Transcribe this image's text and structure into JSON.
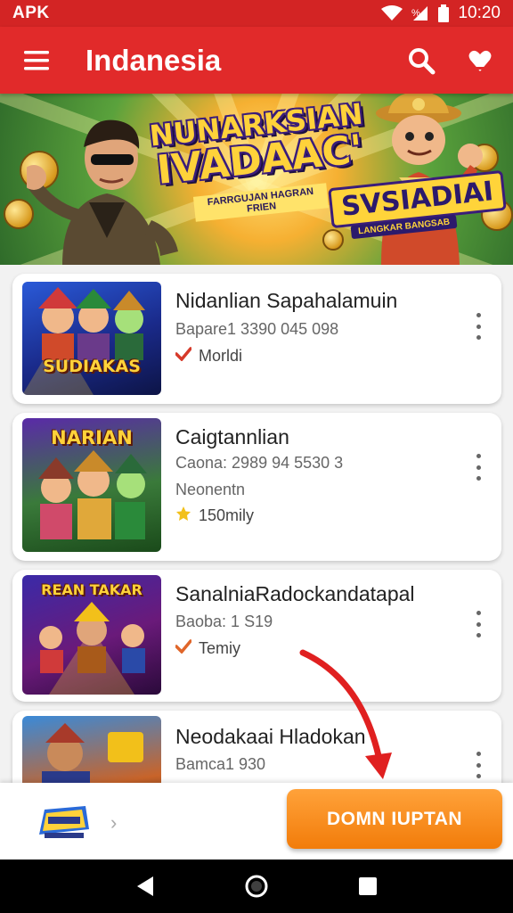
{
  "status_bar": {
    "left_label": "APK",
    "time": "10:20"
  },
  "app_bar": {
    "title": "Indanesia",
    "menu_icon": "menu-icon",
    "search_icon": "search-icon",
    "favorite_icon": "heart-icon"
  },
  "banner": {
    "title_line1": "NUNARKSIAN",
    "title_line2": "IVADAAC'",
    "subtitle": "FARRGUJAN HAGRAN FRIEN",
    "logo_text": "SVSIADIAI",
    "logo_sub": "LANGKAR BANGSAB",
    "slides_total": 3,
    "slide_active": 2
  },
  "games": [
    {
      "title": "Nidanlian Sapahalamuin",
      "subtitle": "Bapare1 3390 045 098",
      "meta_icon": "check-icon",
      "meta_text": "Morldi",
      "thumb_label": "SUDIAKAS"
    },
    {
      "title": "Caigtannlian",
      "subtitle": "Caona: 2989 94 5530 3",
      "subtitle2": "Neonentn",
      "meta_icon": "star-icon",
      "meta_text": "150mily",
      "thumb_label": "NARIAN"
    },
    {
      "title": "SanalniaRadockandatapal",
      "subtitle": "Baoba: 1 S19",
      "meta_icon": "check-icon",
      "meta_text": "Temiy",
      "thumb_label": "REAN TAKAR"
    },
    {
      "title": "Neodakaai Hladokan",
      "subtitle": "Bamca1 930",
      "thumb_label": ""
    }
  ],
  "bottom": {
    "logo_icon": "game-logo-icon",
    "cta_label": "DOMN IUPTAN"
  },
  "colors": {
    "brand_red": "#e12a2a",
    "cta_orange": "#f58a12",
    "check_red": "#d63a2a",
    "star_yellow": "#f2c01a"
  }
}
